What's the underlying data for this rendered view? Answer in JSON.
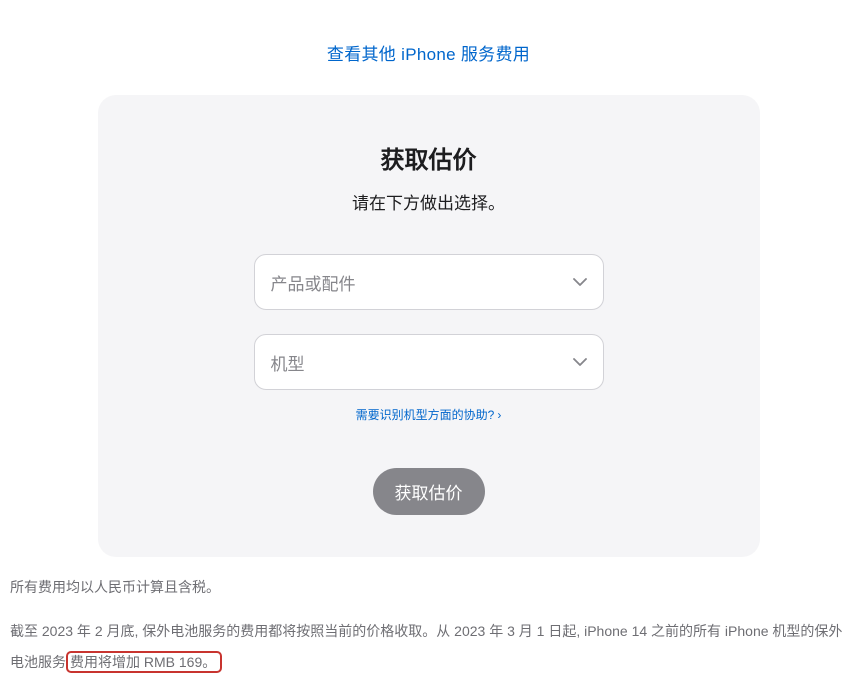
{
  "topLink": {
    "label": "查看其他 iPhone 服务费用"
  },
  "card": {
    "title": "获取估价",
    "subtitle": "请在下方做出选择。",
    "select1": {
      "placeholder": "产品或配件"
    },
    "select2": {
      "placeholder": "机型"
    },
    "helpLink": {
      "label": "需要识别机型方面的协助?"
    },
    "submitButton": {
      "label": "获取估价"
    }
  },
  "footer": {
    "line1": "所有费用均以人民币计算且含税。",
    "line2_part1": "截至 2023 年 2 月底, 保外电池服务的费用都将按照当前的价格收取。从 2023 年 3 月 1 日起, iPhone 14 之前的所有 iPhone 机型的保外电池服务",
    "line2_highlight": "费用将增加 RMB 169。"
  }
}
